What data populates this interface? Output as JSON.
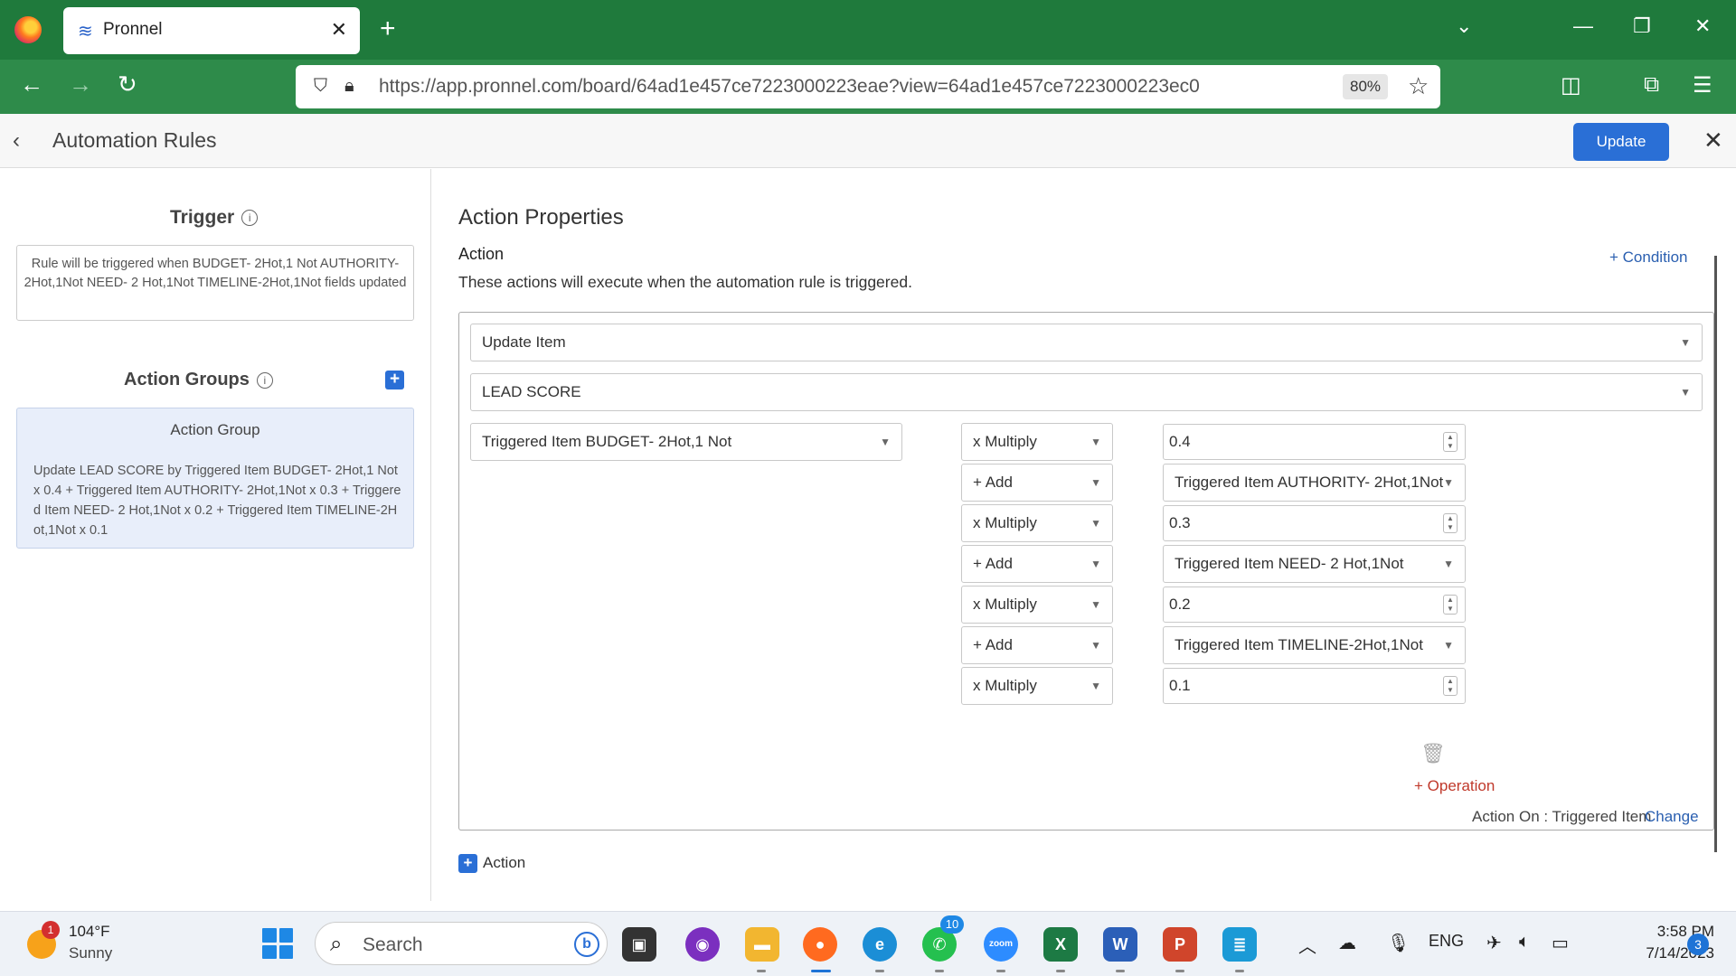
{
  "browser": {
    "tab_title": "Pronnel",
    "url": "https://app.pronnel.com/board/64ad1e457ce7223000223eae?view=64ad1e457ce7223000223ec0",
    "zoom": "80%"
  },
  "header": {
    "title": "Automation Rules",
    "update_label": "Update"
  },
  "left": {
    "trigger_heading": "Trigger",
    "trigger_text": "Rule will be triggered when BUDGET- 2Hot,1 Not AUTHORITY- 2Hot,1Not NEED- 2 Hot,1Not TIMELINE-2Hot,1Not fields updated",
    "action_groups_heading": "Action Groups",
    "action_group_title": "Action Group",
    "action_group_desc": "Update LEAD SCORE by Triggered Item BUDGET- 2Hot,1 Not x 0.4 + Triggered Item AUTHORITY- 2Hot,1Not x 0.3 + Triggered Item NEED- 2 Hot,1Not x 0.2 + Triggered Item TIMELINE-2Hot,1Not x 0.1"
  },
  "main": {
    "heading": "Action Properties",
    "action_label": "Action",
    "action_desc": "These actions will execute when the automation rule is triggered.",
    "add_condition": "+ Condition",
    "action_type": "Update Item",
    "target_field": "LEAD SCORE",
    "source_field": "Triggered Item BUDGET- 2Hot,1 Not",
    "operations": [
      {
        "op": "x Multiply",
        "value": "0.4",
        "kind": "number"
      },
      {
        "op": "+ Add",
        "value": "Triggered Item AUTHORITY- 2Hot,1Not",
        "kind": "select"
      },
      {
        "op": "x Multiply",
        "value": "0.3",
        "kind": "number"
      },
      {
        "op": "+ Add",
        "value": "Triggered Item NEED- 2 Hot,1Not",
        "kind": "select"
      },
      {
        "op": "x Multiply",
        "value": "0.2",
        "kind": "number"
      },
      {
        "op": "+ Add",
        "value": "Triggered Item TIMELINE-2Hot,1Not",
        "kind": "select"
      },
      {
        "op": "x Multiply",
        "value": "0.1",
        "kind": "number"
      }
    ],
    "add_operation": "+ Operation",
    "action_on": "Action On : Triggered Item",
    "change": "Change",
    "add_action": "Action"
  },
  "taskbar": {
    "weather_temp": "104°F",
    "weather_cond": "Sunny",
    "weather_badge": "1",
    "search_placeholder": "Search",
    "whatsapp_badge": "10",
    "language": "ENG",
    "time": "3:58 PM",
    "date": "7/14/2023",
    "notifications": "3"
  }
}
